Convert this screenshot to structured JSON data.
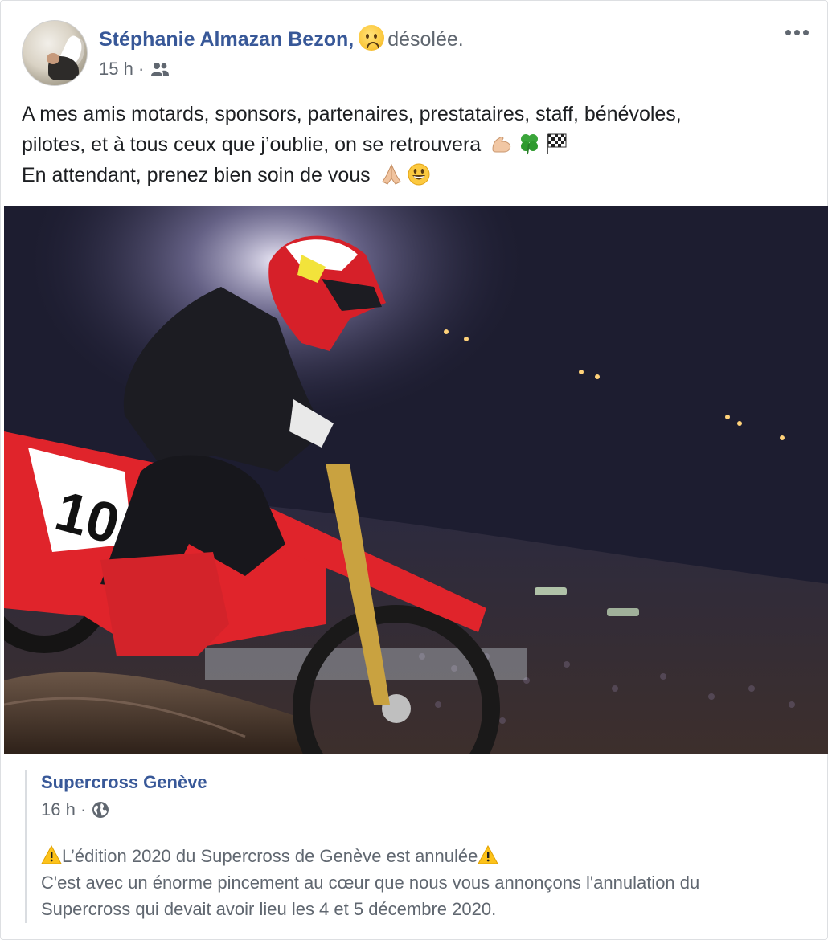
{
  "post": {
    "author_name": "Stéphanie Almazan Bezon,",
    "feeling_text": "désolée.",
    "feeling_icon": "worried-face-emoji",
    "time": "15 h",
    "separator": "·",
    "audience_icon": "friends-icon",
    "more_icon": "more-dots-icon",
    "text_line_1": "A mes amis motards, sponsors, partenaires, prestataires, staff, bénévoles,",
    "text_line_2": "pilotes, et à tous ceux que j’oublie, on se retrouvera",
    "text_line_3": "En attendant, prenez bien soin de vous",
    "line2_icons": [
      "flexed-biceps-emoji",
      "four-leaf-clover-emoji",
      "checkered-flag-emoji"
    ],
    "line3_icons": [
      "folded-hands-emoji",
      "grinning-face-emoji"
    ]
  },
  "photo": {
    "description_icon": "motocross-rider-photo",
    "bike_number": "10"
  },
  "shared_post": {
    "page_name": "Supercross Genève",
    "time": "16 h",
    "separator": "·",
    "audience_icon": "globe-icon",
    "line_1": "L’édition 2020 du Supercross de Genève est annulée",
    "line_2": "C'est avec un énorme pincement au cœur que nous vous annonçons l'annulation du",
    "line_3": "Supercross qui devait avoir lieu les 4 et 5 décembre 2020.",
    "warning_icon": "warning-emoji"
  },
  "colors": {
    "link_blue": "#385898",
    "meta_gray": "#606770",
    "text_dark": "#1c1e21",
    "bike_red": "#e0242b"
  }
}
